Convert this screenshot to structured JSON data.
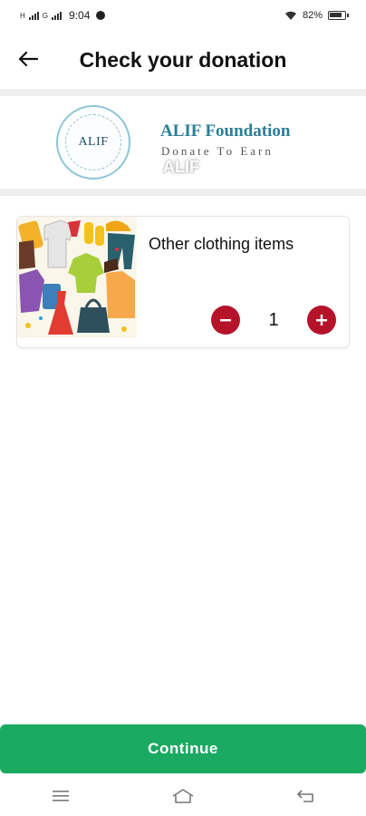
{
  "status_bar": {
    "left_small": "H",
    "left_small2": "G",
    "time": "9:04",
    "battery": "82%"
  },
  "header": {
    "title": "Check your donation",
    "back_icon": "arrow-left-icon"
  },
  "foundation": {
    "logo_text": "ALIF",
    "name": "ALIF Foundation",
    "tagline": "Donate To Earn",
    "watermark": "ALIF"
  },
  "item": {
    "name": "Other clothing items",
    "quantity": "1",
    "decrement_icon": "minus-icon",
    "increment_icon": "plus-icon"
  },
  "continue_label": "Continue",
  "colors": {
    "accent_red": "#b5132a",
    "primary_green": "#1aaa62",
    "brand_teal": "#2a7f97"
  },
  "nav": {
    "menu_icon": "menu-icon",
    "home_icon": "home-icon",
    "back_icon": "back-icon"
  }
}
